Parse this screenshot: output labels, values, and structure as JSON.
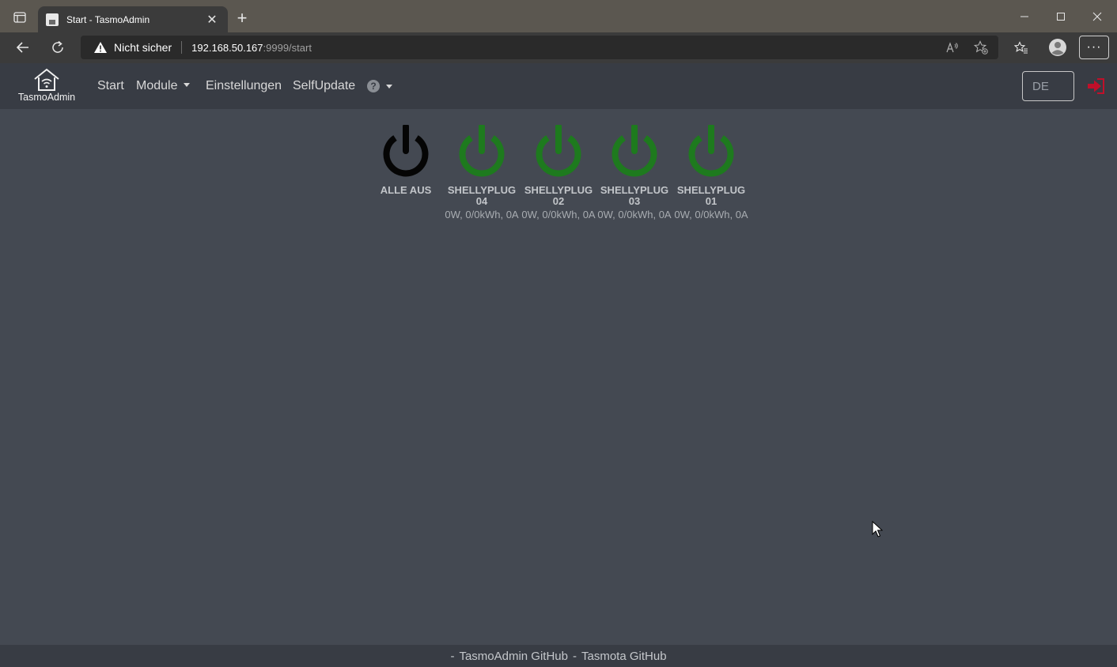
{
  "browser": {
    "tab_title": "Start - TasmoAdmin",
    "tab_close": "✕",
    "new_tab": "+",
    "not_secure": "Nicht sicher",
    "url_host": "192.168.50.167",
    "url_rest": ":9999/start",
    "minimize": "—",
    "maximize": "☐",
    "close": "✕",
    "more": "···"
  },
  "navbar": {
    "brand": "TasmoAdmin",
    "links": {
      "start": "Start",
      "module": "Module",
      "einstellungen": "Einstellungen",
      "selfupdate": "SelfUpdate"
    },
    "help_glyph": "?",
    "language": "DE"
  },
  "devices": [
    {
      "name": "ALLE AUS",
      "stats": "",
      "color": "#050505"
    },
    {
      "name": "SHELLYPLUG 04",
      "stats": "0W, 0/0kWh, 0A",
      "color": "#1e7a1e"
    },
    {
      "name": "SHELLYPLUG 02",
      "stats": "0W, 0/0kWh, 0A",
      "color": "#1e7a1e"
    },
    {
      "name": "SHELLYPLUG 03",
      "stats": "0W, 0/0kWh, 0A",
      "color": "#1e7a1e"
    },
    {
      "name": "SHELLYPLUG 01",
      "stats": "0W, 0/0kWh, 0A",
      "color": "#1e7a1e"
    }
  ],
  "footer": {
    "sep1": "-",
    "tasmoadmin_github": "TasmoAdmin GitHub",
    "sep2": "-",
    "tasmota_github": "Tasmota GitHub"
  },
  "colors": {
    "background": "#444952",
    "navbar": "#383c44",
    "power_on": "#1e7a1e",
    "power_all_off": "#050505",
    "logout": "#c0102a"
  }
}
